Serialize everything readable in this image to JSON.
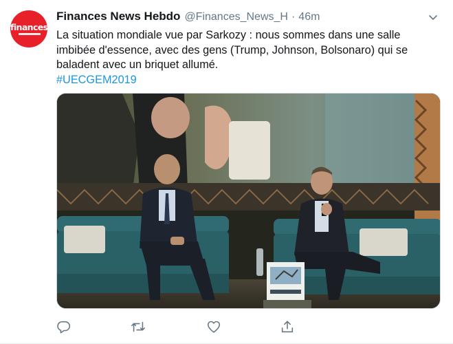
{
  "tweet": {
    "avatar": {
      "logo_text": "finances",
      "accent": "#e8202a"
    },
    "display_name": "Finances News Hebdo",
    "handle": "@Finances_News_H",
    "separator": "·",
    "time": "46m",
    "text_lines": [
      "La situation mondiale vue par Sarkozy : nous sommes dans  une salle",
      "imbibée d'essence, avec des gens (Trump, Johnson, Bolsonaro) qui se",
      "baladent avec un briquet allumé."
    ],
    "hashtag": "#UECGEM2019",
    "link_color": "#1b95e0",
    "icons": {
      "menu": "chevron-down-icon",
      "reply": "reply-icon",
      "retweet": "retweet-icon",
      "like": "heart-icon",
      "share": "share-icon"
    }
  }
}
